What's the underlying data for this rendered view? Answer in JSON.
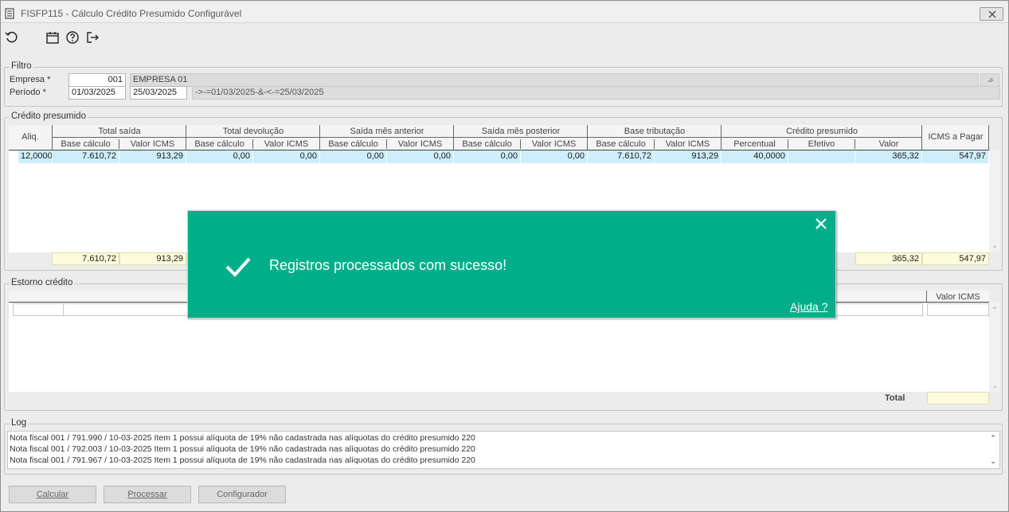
{
  "window": {
    "title": "FISFP115 - Cálculo Crédito Presumido Configurável",
    "close_icon": "close-icon"
  },
  "toolbar": {
    "icons": [
      "refresh-icon",
      "calendar-icon",
      "help-icon",
      "exit-icon"
    ]
  },
  "filtro": {
    "legend": "Filtro",
    "empresa_label": "Empresa *",
    "empresa_code": "001",
    "empresa_name": "EMPRESA 01",
    "periodo_label": "Período *",
    "periodo_start": "01/03/2025",
    "periodo_end": "25/03/2025",
    "periodo_expr": "->-=01/03/2025-&-<-=25/03/2025"
  },
  "credito": {
    "legend": "Crédito presumido",
    "aliq_header": "Aliq.",
    "groups": [
      "Total saída",
      "Total devolução",
      "Saída mês anterior",
      "Saída mês posterior",
      "Base tributação",
      "Crédito presumido"
    ],
    "icms_header": "ICMS a Pagar",
    "subheaders": [
      "Base cálculo",
      "Valor ICMS",
      "Base cálculo",
      "Valor ICMS",
      "Base cálculo",
      "Valor ICMS",
      "Base cálculo",
      "Valor ICMS",
      "Base cálculo",
      "Valor ICMS",
      "Percentual",
      "Efetivo",
      "Valor"
    ],
    "row": [
      "12,0000",
      "7.610,72",
      "913,29",
      "0,00",
      "0,00",
      "0,00",
      "0,00",
      "0,00",
      "0,00",
      "7.610,72",
      "913,29",
      "40,0000",
      "",
      "365,32",
      "547,97"
    ],
    "totals": {
      "base": "7.610,72",
      "icms": "913,29",
      "valor": "365,32",
      "icms_pagar": "547,97"
    }
  },
  "estorno": {
    "legend": "Estorno crédito",
    "valor_icms_header": "Valor ICMS",
    "total_label": "Total",
    "total_value": ""
  },
  "log": {
    "legend": "Log",
    "lines": [
      "Nota fiscal 001 / 791.990 / 10-03-2025 Item 1 possui alíquota de 19% não cadastrada nas alíquotas do crédito presumido 220",
      "Nota fiscal 001 / 792.003 / 10-03-2025 Item 1 possui alíquota de 19% não cadastrada nas alíquotas do crédito presumido 220",
      "Nota fiscal 001 / 791.967 / 10-03-2025 Item 1 possui alíquota de 19% não cadastrada nas alíquotas do crédito presumido 220"
    ]
  },
  "buttons": {
    "calcular": "Calcular",
    "processar": "Processar",
    "configurador": "Configurador"
  },
  "toast": {
    "message": "Registros processados com sucesso!",
    "help_link": "Ajuda ?",
    "bg_color": "#00af8a"
  }
}
